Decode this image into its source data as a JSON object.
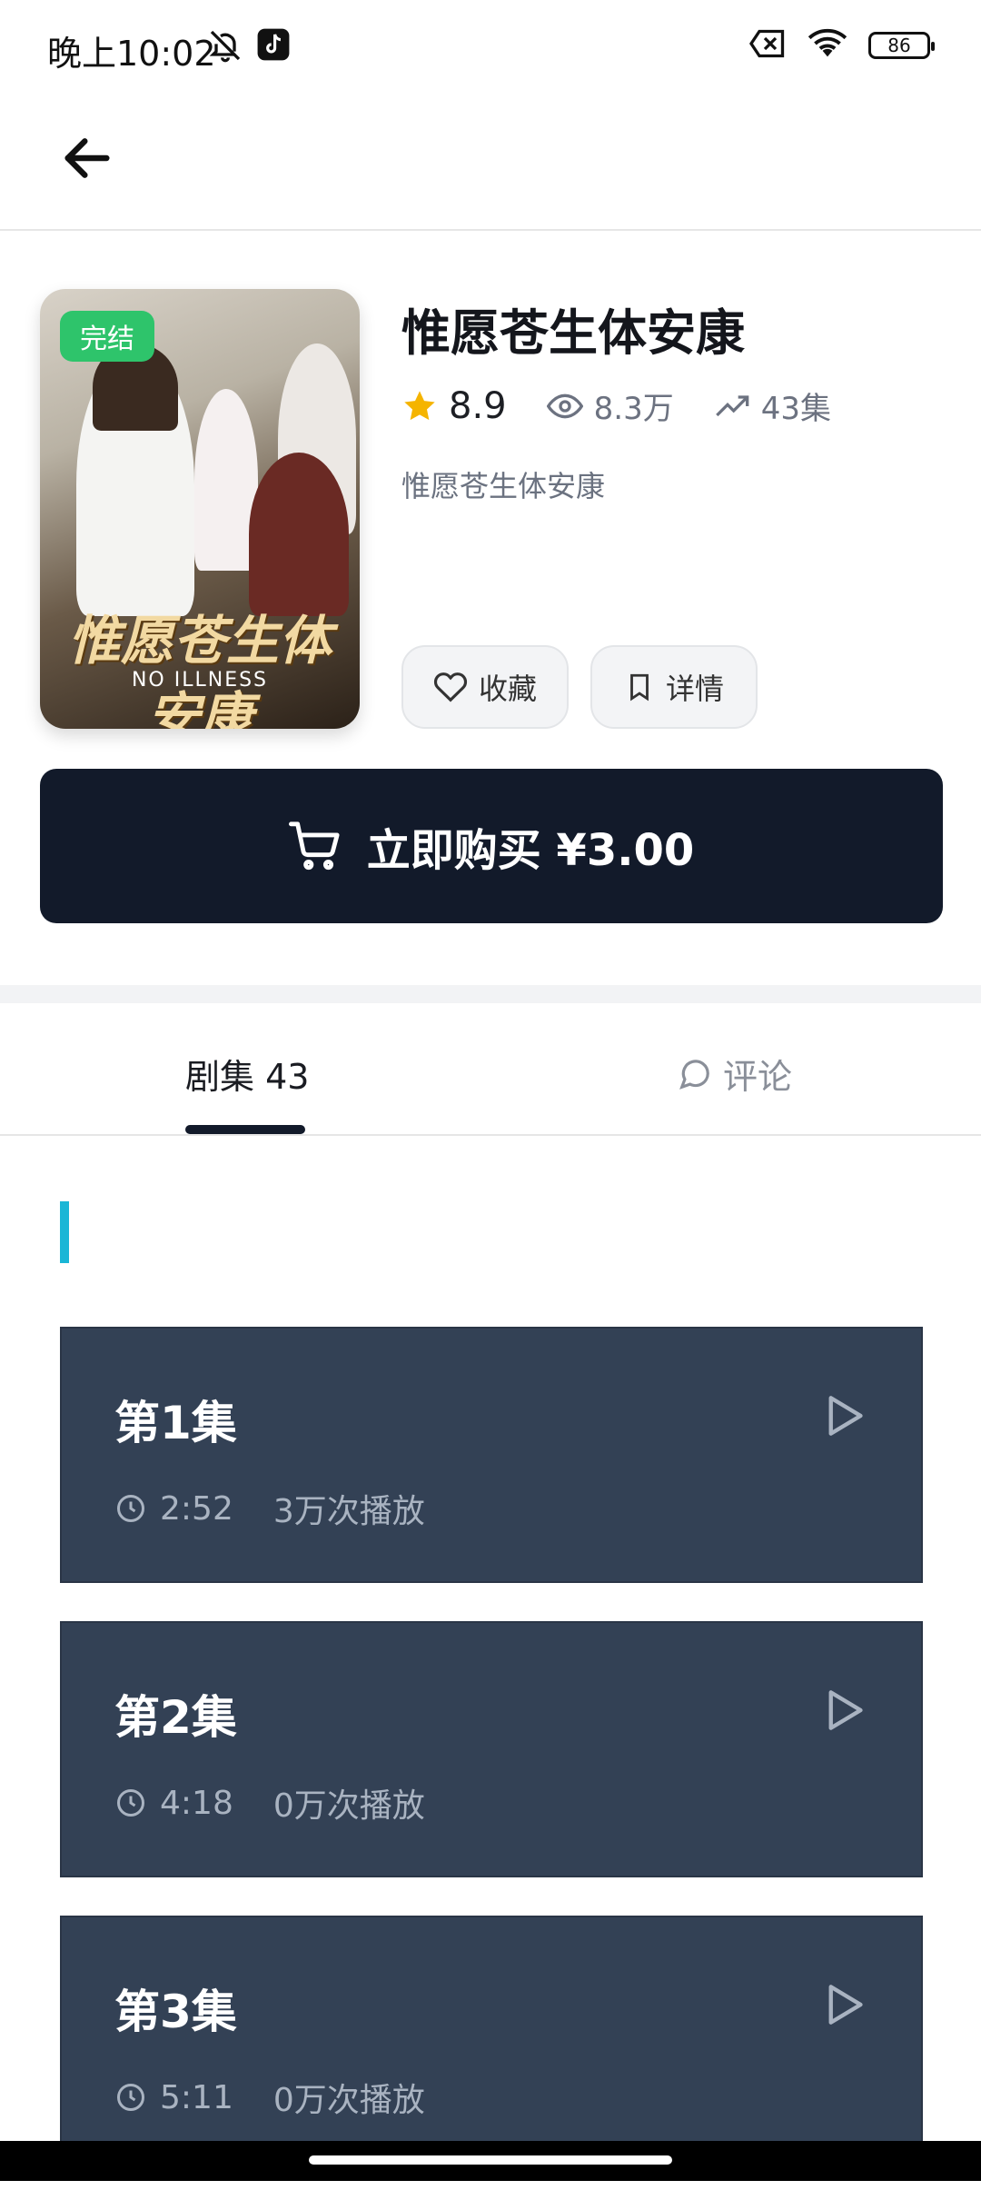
{
  "status_bar": {
    "time": "晚上10:02",
    "battery": "86",
    "icons": [
      "bell-off-icon",
      "tiktok-icon",
      "sim-off-icon",
      "wifi-icon",
      "battery-icon"
    ]
  },
  "nav": {
    "back_icon": "arrow-left-icon"
  },
  "drama": {
    "badge": "完结",
    "poster_title": "惟愿苍生体安康",
    "poster_subtitle": "NO ILLNESS",
    "title": "惟愿苍生体安康",
    "rating": "8.9",
    "views": "8.3万",
    "episodes_count": "43集",
    "subtitle": "惟愿苍生体安康",
    "favorite_label": "收藏",
    "details_label": "详情",
    "buy_label": "立即购买 ¥3.00"
  },
  "tabs": {
    "episodes_label": "剧集 43",
    "comments_label": "评论"
  },
  "episodes": [
    {
      "title": "第1集",
      "duration": "2:52",
      "plays": "3万次播放"
    },
    {
      "title": "第2集",
      "duration": "4:18",
      "plays": "0万次播放"
    },
    {
      "title": "第3集",
      "duration": "5:11",
      "plays": "0万次播放"
    }
  ],
  "colors": {
    "buy_button_bg": "#121a2a",
    "badge_green": "#2ec46b",
    "episode_card_bg": "#334155",
    "accent_bar": "#1ab6d6",
    "star": "#f5b400"
  }
}
